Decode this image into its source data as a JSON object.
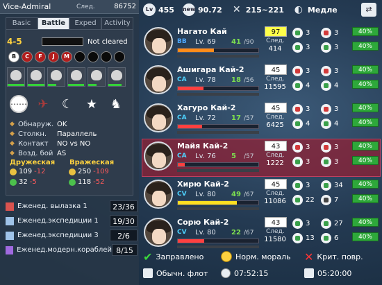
{
  "header": {
    "name": "Vice-Admiral",
    "next_label": "След.",
    "exp": "86752"
  },
  "tabs": [
    {
      "label": "Basic"
    },
    {
      "label": "Battle"
    },
    {
      "label": "Exped"
    },
    {
      "label": "Activity"
    }
  ],
  "battle": {
    "map": "4-5",
    "status": "Not cleared",
    "nodes": [
      {
        "label": "B",
        "kind": "start"
      },
      {
        "label": "C",
        "kind": "red"
      },
      {
        "label": "F",
        "kind": "red"
      },
      {
        "label": "J",
        "kind": "red"
      },
      {
        "label": "M",
        "kind": "red"
      },
      {
        "label": "",
        "kind": "black"
      },
      {
        "label": "",
        "kind": "black"
      },
      {
        "label": "",
        "kind": "black"
      },
      {
        "label": "",
        "kind": "black"
      }
    ],
    "enemy_hp": [
      1.0,
      1.0,
      0.5,
      0.95,
      0.5,
      0.8
    ],
    "formations": [
      {
        "icon": "line-ahead-icon",
        "glyph": "⋯⋯"
      },
      {
        "icon": "enemy-formation-icon",
        "glyph": "✈"
      },
      {
        "icon": "moon-icon",
        "glyph": "☾"
      },
      {
        "icon": "star-icon",
        "glyph": "★"
      },
      {
        "icon": "ship-girl-icon",
        "glyph": "♞"
      }
    ],
    "info": [
      {
        "key": "Обнаруж.",
        "value": "OK"
      },
      {
        "key": "Столкн.",
        "value": "Параллель"
      },
      {
        "key": "Контакт",
        "value": "NO vs NO"
      },
      {
        "key": "Возд. бой",
        "value": "AS"
      }
    ],
    "friendly_label": "Дружеская",
    "enemy_label": "Вражеская",
    "friendly": [
      {
        "value": "109",
        "loss": "-12"
      },
      {
        "value": "32",
        "loss": "-5"
      }
    ],
    "enemy": [
      {
        "value": "250",
        "loss": "-109"
      },
      {
        "value": "118",
        "loss": "-52"
      }
    ]
  },
  "quests": [
    {
      "name": "Еженед. вылазка 1",
      "progress": "23/36",
      "color": "#d9534f"
    },
    {
      "name": "Еженед.экспедиции 1",
      "progress": "19/30",
      "color": "#9fc3e8"
    },
    {
      "name": "Еженед.экспедиции 3",
      "progress": "2/6",
      "color": "#9fc3e8"
    },
    {
      "name": "Еженед.модерн.кораблей",
      "progress": "8/15",
      "color": "#a06ae0"
    }
  ],
  "topbar": {
    "level": "455",
    "rating": "90.72",
    "range": "215~221",
    "speed": "Медле"
  },
  "ships": [
    {
      "name": "Нагато Кай",
      "type": "BB",
      "type_color": "#4fa8ff",
      "level": "Lv. 69",
      "hp": "41",
      "hpmax": "/90",
      "hp_frac": 0.45,
      "hp_color": "#ff8c1a",
      "cond": "97",
      "spark": true,
      "next_label": "След.",
      "next": "414",
      "equips": [
        [
          "torp",
          "3"
        ],
        [
          "gun",
          "3"
        ],
        [
          "torp",
          "3"
        ],
        [
          "torp",
          "3"
        ]
      ],
      "fuel": [
        "40%",
        "40%"
      ]
    },
    {
      "name": "Ашигара Кай-2",
      "type": "CA",
      "type_color": "#4fd3ff",
      "level": "Lv. 78",
      "hp": "18",
      "hpmax": "/56",
      "hp_frac": 0.32,
      "hp_color": "#ff4040",
      "cond": "45",
      "spark": false,
      "next_label": "След.",
      "next": "11595",
      "equips": [
        [
          "gun",
          "3"
        ],
        [
          "gun",
          "3"
        ],
        [
          "torp",
          "4"
        ],
        [
          "torp",
          "4"
        ]
      ],
      "fuel": [
        "40%",
        "40%"
      ]
    },
    {
      "name": "Хагуро Кай-2",
      "type": "CA",
      "type_color": "#4fd3ff",
      "level": "Lv. 72",
      "hp": "17",
      "hpmax": "/57",
      "hp_frac": 0.3,
      "hp_color": "#ff4040",
      "cond": "45",
      "spark": false,
      "next_label": "След.",
      "next": "6425",
      "equips": [
        [
          "gun",
          "3"
        ],
        [
          "gun",
          "3"
        ],
        [
          "torp",
          "4"
        ],
        [
          "torp",
          "4"
        ]
      ],
      "fuel": [
        "40%",
        "40%"
      ]
    },
    {
      "name": "Майя Кай-2",
      "type": "CA",
      "type_color": "#4fd3ff",
      "level": "Lv. 76",
      "hp": "5",
      "hpmax": "/57",
      "hp_frac": 0.09,
      "hp_color": "#ff4040",
      "cond": "43",
      "spark": false,
      "next_label": "След.",
      "next": "1222",
      "equips": [
        [
          "gun",
          "3"
        ],
        [
          "gun",
          "3"
        ],
        [
          "torp",
          "3"
        ],
        [
          "torp",
          "3"
        ]
      ],
      "fuel": [
        "40%",
        "40%"
      ]
    },
    {
      "name": "Хирю Кай-2",
      "type": "CV",
      "type_color": "#4fd3ff",
      "level": "Lv. 80",
      "hp": "49",
      "hpmax": "/67",
      "hp_frac": 0.73,
      "hp_color": "#ffe020",
      "cond": "45",
      "spark": false,
      "next_label": "След.",
      "next": "11086",
      "equips": [
        [
          "torp",
          "3"
        ],
        [
          "torp",
          "34"
        ],
        [
          "torp",
          "22"
        ],
        [
          "rad",
          "7"
        ]
      ],
      "fuel": [
        "40%",
        "40%"
      ]
    },
    {
      "name": "Сорю Кай-2",
      "type": "CV",
      "type_color": "#4fd3ff",
      "level": "Lv. 80",
      "hp": "22",
      "hpmax": "/67",
      "hp_frac": 0.33,
      "hp_color": "#ff4040",
      "cond": "43",
      "spark": false,
      "next_label": "След.",
      "next": "11580",
      "equips": [
        [
          "torp",
          "3"
        ],
        [
          "torp",
          "27"
        ],
        [
          "torp",
          "13"
        ],
        [
          "torp",
          "6"
        ]
      ],
      "fuel": [
        "40%",
        "40%"
      ]
    }
  ],
  "bottom": {
    "supplied": "Заправлено",
    "morale": "Норм. мораль",
    "damage": "Крит. повр.",
    "fleet": "Обычн. флот",
    "timer1": "07:52:15",
    "timer2": "05:20:00"
  }
}
